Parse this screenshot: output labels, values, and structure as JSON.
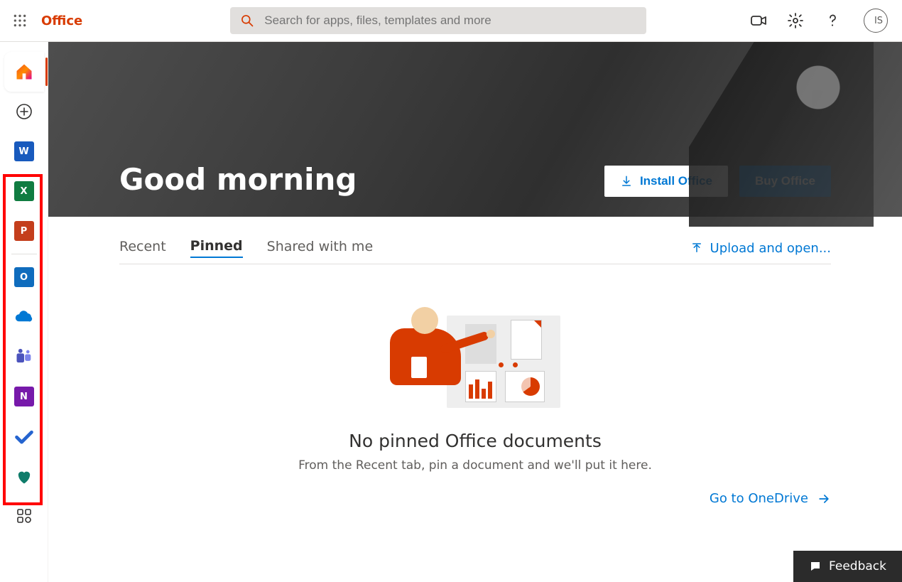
{
  "header": {
    "brand": "Office",
    "search_placeholder": "Search for apps, files, templates and more",
    "avatar_initials": "IS"
  },
  "rail": {
    "home": "Home",
    "create": "Create",
    "apps": [
      {
        "name": "Word",
        "letter": "W",
        "bg": "#185abd",
        "accent": "#2b7cd3"
      },
      {
        "name": "Excel",
        "letter": "X",
        "bg": "#107c41",
        "accent": "#21a366"
      },
      {
        "name": "PowerPoint",
        "letter": "P",
        "bg": "#c43e1c",
        "accent": "#ed6c47"
      },
      {
        "name": "Outlook",
        "letter": "O",
        "bg": "#0f6cbd",
        "accent": "#28a8ea"
      },
      {
        "name": "OneDrive",
        "letter": "",
        "bg": "#0078d4",
        "accent": "#0078d4"
      },
      {
        "name": "Teams",
        "letter": "",
        "bg": "#4b53bc",
        "accent": "#7b83eb"
      },
      {
        "name": "OneNote",
        "letter": "N",
        "bg": "#7719aa",
        "accent": "#9a36c8"
      }
    ],
    "todo": "To Do",
    "family": "Family Safety",
    "all_apps": "All apps"
  },
  "hero": {
    "greeting": "Good morning",
    "install_label": "Install Office",
    "buy_label": "Buy Office"
  },
  "tabs": {
    "items": [
      "Recent",
      "Pinned",
      "Shared with me"
    ],
    "active_index": 1,
    "upload_label": "Upload and open..."
  },
  "empty_state": {
    "title": "No pinned Office documents",
    "subtitle": "From the Recent tab, pin a document and we'll put it here.",
    "onedrive_label": "Go to OneDrive"
  },
  "feedback": {
    "label": "Feedback"
  }
}
